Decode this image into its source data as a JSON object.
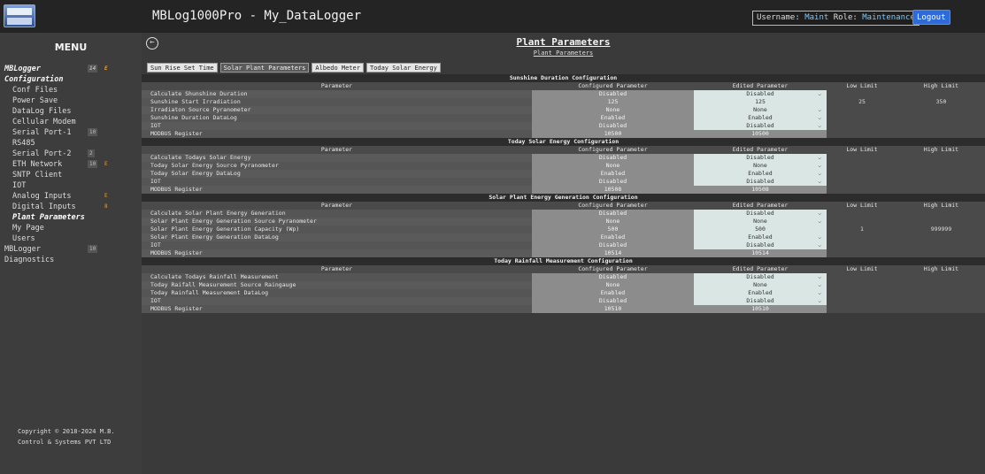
{
  "app": {
    "logo_text": "MB",
    "title": "MBLog1000Pro - My_DataLogger"
  },
  "user": {
    "username_label": "Username:",
    "username": "Maint",
    "role_label": "Role:",
    "role": "Maintenance",
    "logout_label": "Logout"
  },
  "sidebar": {
    "title": "MENU",
    "items": [
      {
        "label": "MBLogger",
        "kind": "hdr",
        "badge": "14",
        "badge2": "E"
      },
      {
        "label": "Configuration",
        "kind": "hdr"
      },
      {
        "label": "Conf Files",
        "kind": "item"
      },
      {
        "label": "Power Save",
        "kind": "item"
      },
      {
        "label": "DataLog Files",
        "kind": "item"
      },
      {
        "label": "Cellular Modem",
        "kind": "item"
      },
      {
        "label": "Serial Port-1",
        "kind": "item",
        "badge": "10"
      },
      {
        "label": "RS485",
        "kind": "item"
      },
      {
        "label": "Serial Port-2",
        "kind": "item",
        "badge": "2"
      },
      {
        "label": "ETH Network",
        "kind": "item",
        "badge": "10",
        "badge2": "E"
      },
      {
        "label": "SNTP Client",
        "kind": "item"
      },
      {
        "label": "IOT",
        "kind": "item"
      },
      {
        "label": "Analog Inputs",
        "kind": "item",
        "badge2": "E"
      },
      {
        "label": "Digital Inputs",
        "kind": "item",
        "badge2": "8"
      },
      {
        "label": "Plant Parameters",
        "kind": "active"
      },
      {
        "label": "My Page",
        "kind": "item"
      },
      {
        "label": "Users",
        "kind": "item"
      },
      {
        "label": "MBLogger",
        "kind": "sub",
        "badge": "10"
      },
      {
        "label": "Diagnostics",
        "kind": "sub"
      }
    ],
    "copyright": "Copyright © 2018-2024 M.B. Control & Systems PVT LTD"
  },
  "page": {
    "back_icon": "←",
    "title": "Plant Parameters",
    "breadcrumb": "Plant Parameters"
  },
  "tabs": [
    {
      "label": "Sun Rise Set Time",
      "active": false
    },
    {
      "label": "Solar Plant Parameters",
      "active": true
    },
    {
      "label": "Albedo Meter",
      "active": false
    },
    {
      "label": "Today Solar Energy",
      "active": false
    }
  ],
  "columns": [
    "Parameter",
    "Configured Parameter",
    "Edited Parameter",
    "Low Limit",
    "High Limit"
  ],
  "sections": [
    {
      "title": "Sunshine Duration Configuration",
      "rows": [
        {
          "param": "Calculate Shunshine Duration",
          "configured": "Disabled",
          "edited": "Disabled",
          "select": true,
          "low": "",
          "high": ""
        },
        {
          "param": "Sunshine Start Irradiation",
          "configured": "125",
          "edited": "125",
          "select": false,
          "low": "25",
          "high": "350"
        },
        {
          "param": "Irradiaton Source Pyranometer",
          "configured": "None",
          "edited": "None",
          "select": true,
          "low": "",
          "high": ""
        },
        {
          "param": "Sunshine Duration DataLog",
          "configured": "Enabled",
          "edited": "Enabled",
          "select": true,
          "low": "",
          "high": ""
        },
        {
          "param": "IOT",
          "configured": "Disabled",
          "edited": "Disabled",
          "select": true,
          "low": "",
          "high": ""
        },
        {
          "param": "MODBUS Register",
          "configured": "10500",
          "edited": "10500",
          "select": false,
          "plain": true,
          "low": "",
          "high": ""
        }
      ]
    },
    {
      "title": "Today Solar Energy Configuration",
      "rows": [
        {
          "param": "Calculate Todays Solar Energy",
          "configured": "Disabled",
          "edited": "Disabled",
          "select": true,
          "low": "",
          "high": ""
        },
        {
          "param": "Today Solar Energy Source Pyranometer",
          "configured": "None",
          "edited": "None",
          "select": true,
          "low": "",
          "high": ""
        },
        {
          "param": "Today Solar Energy DataLog",
          "configured": "Enabled",
          "edited": "Enabled",
          "select": true,
          "low": "",
          "high": ""
        },
        {
          "param": "IOT",
          "configured": "Disabled",
          "edited": "Disabled",
          "select": true,
          "low": "",
          "high": ""
        },
        {
          "param": "MODBUS Register",
          "configured": "10508",
          "edited": "10508",
          "select": false,
          "plain": true,
          "low": "",
          "high": ""
        }
      ]
    },
    {
      "title": "Solar Plant Energy Generation Configuration",
      "rows": [
        {
          "param": "Calculate Solar Plant Energy Generation",
          "configured": "Disabled",
          "edited": "Disabled",
          "select": true,
          "low": "",
          "high": ""
        },
        {
          "param": "Solar Plant Energy Generation Source Pyranometer",
          "configured": "None",
          "edited": "None",
          "select": true,
          "low": "",
          "high": ""
        },
        {
          "param": "Solar Plant Energy Generation Capacity (Wp)",
          "configured": "500",
          "edited": "500",
          "select": false,
          "low": "1",
          "high": "999999"
        },
        {
          "param": "Solar Plant Energy Generation DataLog",
          "configured": "Enabled",
          "edited": "Enabled",
          "select": true,
          "low": "",
          "high": ""
        },
        {
          "param": "IOT",
          "configured": "Disabled",
          "edited": "Disabled",
          "select": true,
          "low": "",
          "high": ""
        },
        {
          "param": "MODBUS Register",
          "configured": "10514",
          "edited": "10514",
          "select": false,
          "plain": true,
          "low": "",
          "high": ""
        }
      ]
    },
    {
      "title": "Today Rainfall Measurement Configuration",
      "rows": [
        {
          "param": "Calculate Todays Rainfall Measurement",
          "configured": "Disabled",
          "edited": "Disabled",
          "select": true,
          "low": "",
          "high": ""
        },
        {
          "param": "Today Raifall Measurement Source Raingauge",
          "configured": "None",
          "edited": "None",
          "select": true,
          "low": "",
          "high": ""
        },
        {
          "param": "Today Rainfall Measurement DataLog",
          "configured": "Enabled",
          "edited": "Enabled",
          "select": true,
          "low": "",
          "high": ""
        },
        {
          "param": "IOT",
          "configured": "Disabled",
          "edited": "Disabled",
          "select": true,
          "low": "",
          "high": ""
        },
        {
          "param": "MODBUS Register",
          "configured": "10510",
          "edited": "10510",
          "select": false,
          "plain": true,
          "low": "",
          "high": ""
        }
      ]
    }
  ]
}
